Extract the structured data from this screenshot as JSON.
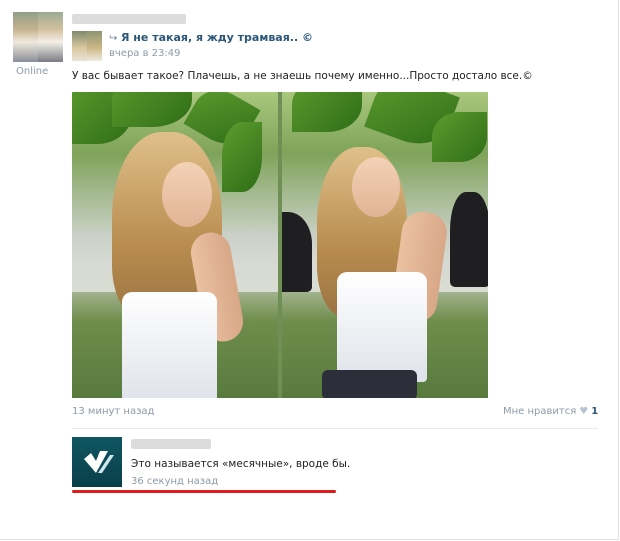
{
  "author": {
    "status": "Online"
  },
  "repost": {
    "group_name": "Я не такая, я жду трамвая.. ©",
    "time": "вчера в 23:49"
  },
  "post": {
    "text": "У вас бывает такое? Плачешь, а не знаешь почему именно...Просто достало все.©",
    "time": "13 минут назад",
    "like_label": "Мне нравится",
    "like_count": "1"
  },
  "comment": {
    "text": "Это называется «месячные», вроде бы.",
    "time": "36 секунд назад"
  },
  "icons": {
    "repost": "repost-icon",
    "heart": "heart-icon"
  },
  "colors": {
    "link": "#2b587a",
    "meta": "#8e9aa8",
    "underline": "#e01b1b"
  }
}
